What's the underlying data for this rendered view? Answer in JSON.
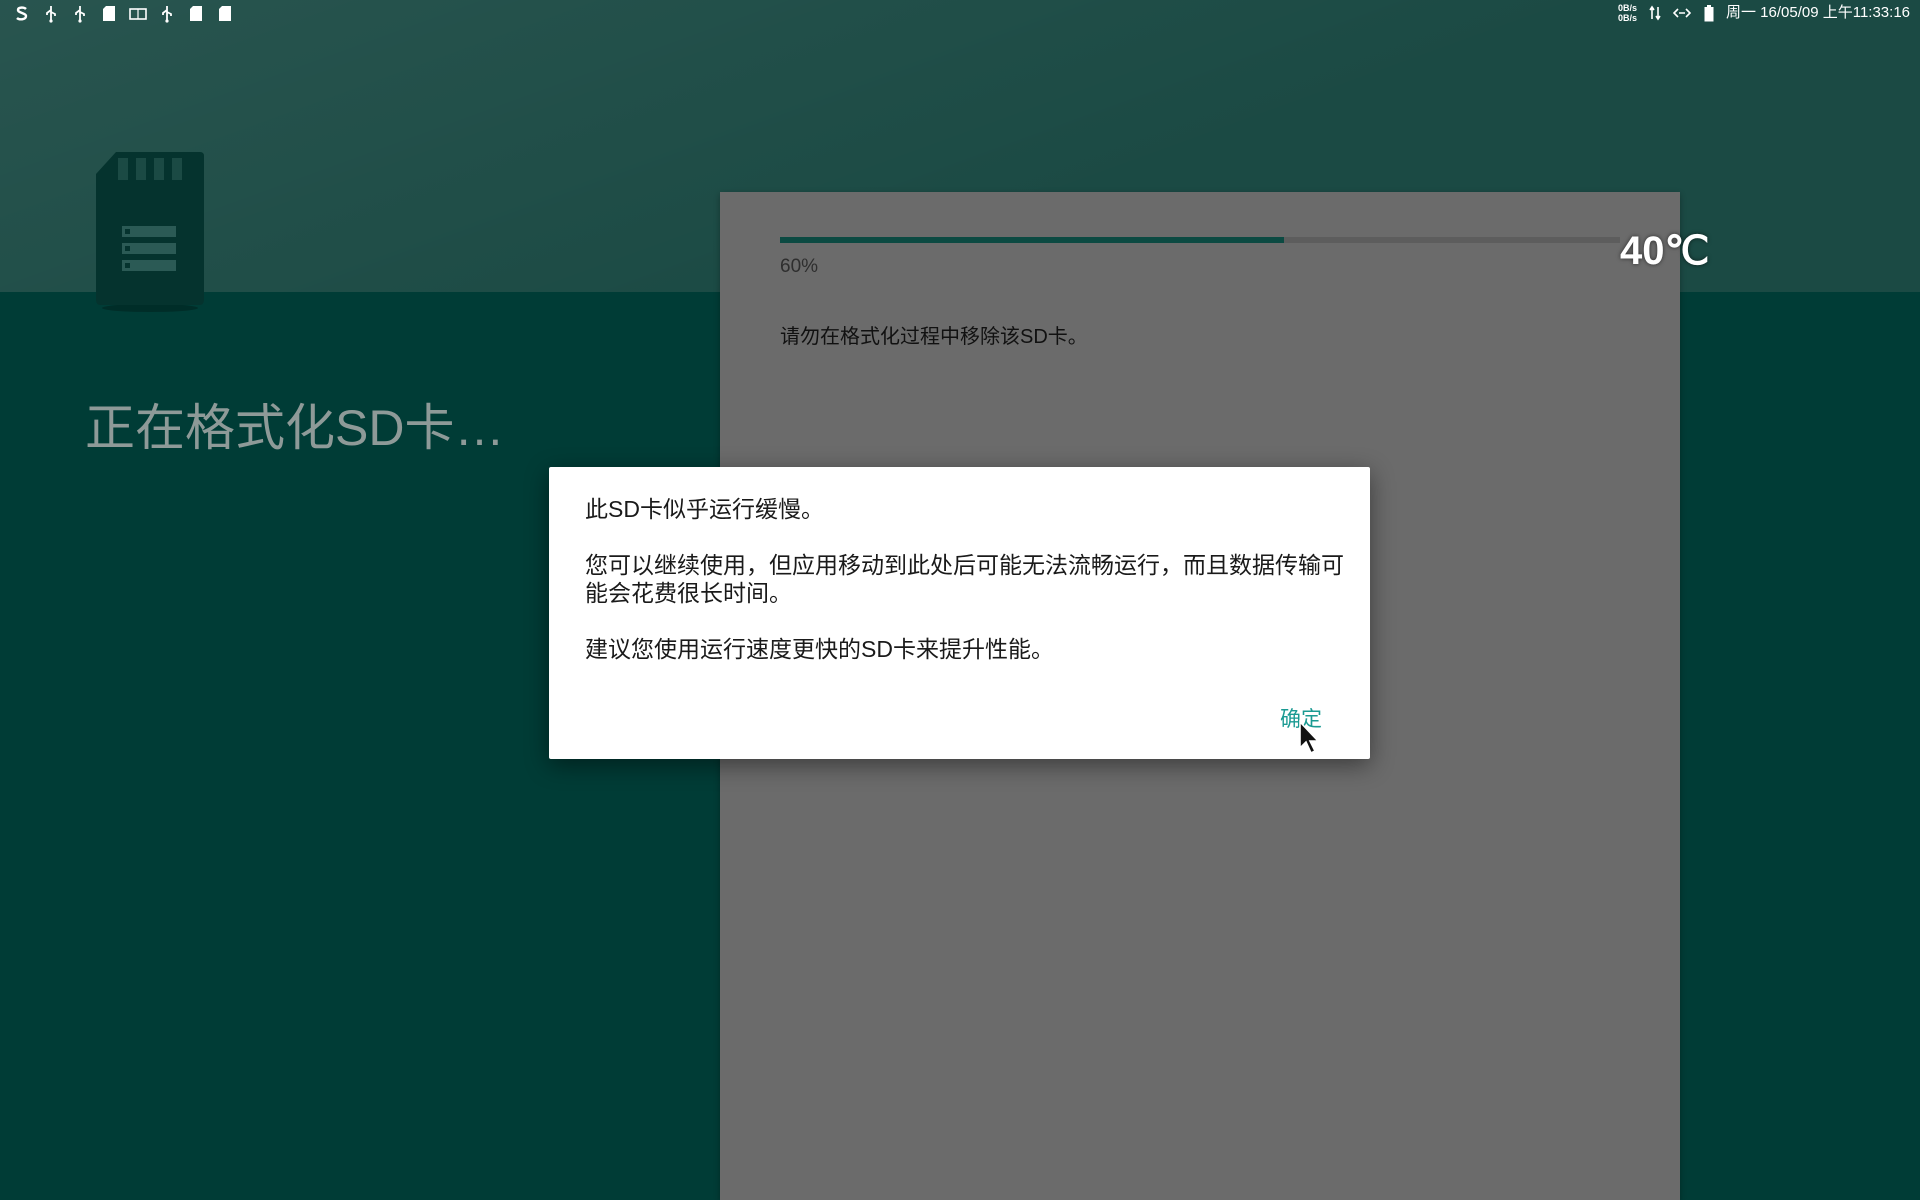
{
  "status_bar": {
    "left_icons": [
      "s-logo-icon",
      "usb-icon",
      "usb-icon",
      "sd-card-icon",
      "screen-icon",
      "usb-icon",
      "sd-card-icon",
      "sd-card-icon"
    ],
    "net_up": "0B/s",
    "net_down": "0B/s",
    "clock": "周一 16/05/09 上午11:33:16"
  },
  "format_screen": {
    "title": "正在格式化SD卡…",
    "progress_percent": 60,
    "progress_label": "60%",
    "warning": "请勿在格式化过程中移除该SD卡。"
  },
  "temperature": "40℃",
  "dialog": {
    "line1": "此SD卡似乎运行缓慢。",
    "line2": "您可以继续使用，但应用移动到此处后可能无法流畅运行，而且数据传输可能会花费很长时间。",
    "line3": "建议您使用运行速度更快的SD卡来提升性能。",
    "ok_label": "确定"
  },
  "colors": {
    "accent": "#1a9a92",
    "background": "#003c36",
    "progress": "#0c4a42"
  }
}
